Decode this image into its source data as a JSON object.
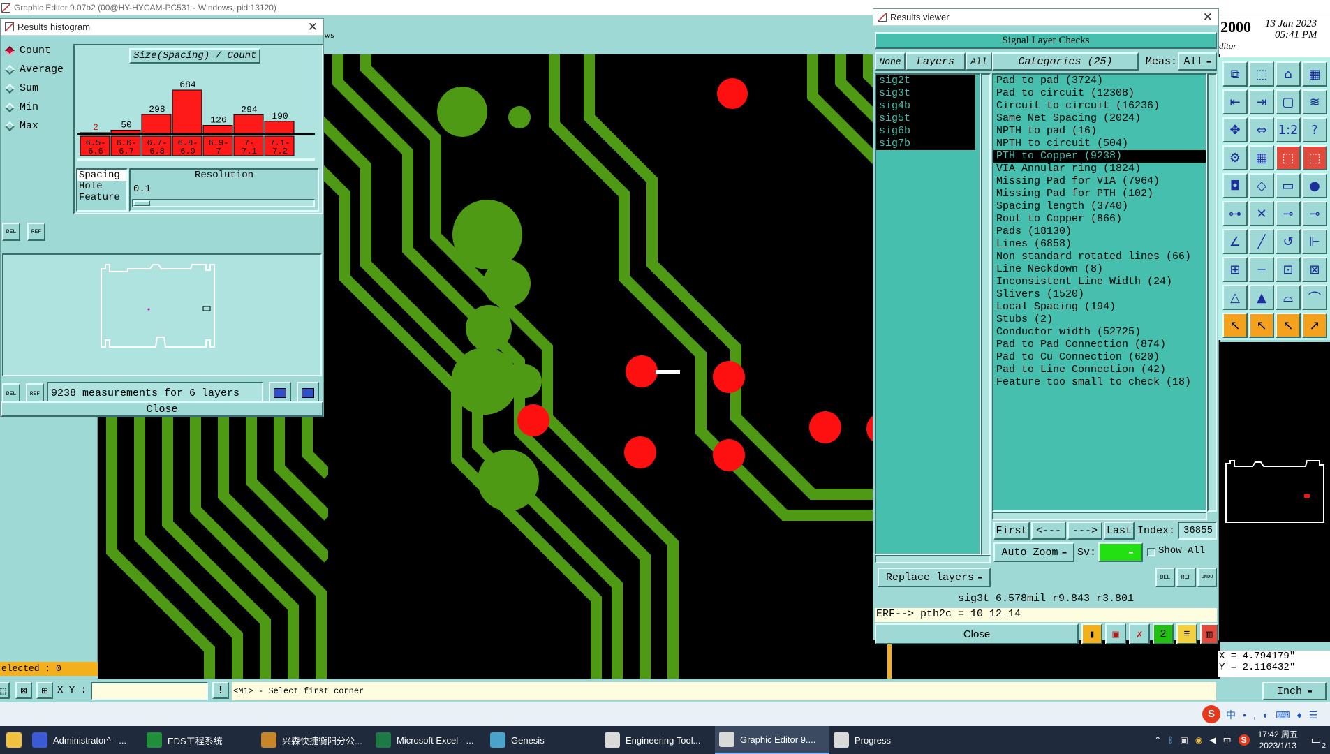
{
  "app": {
    "title": "Graphic Editor 9.07b2 (00@HY-HYCAM-PC531 - Windows, pid:13120)",
    "menu_fragment": "ws",
    "header_date": "13 Jan 2023",
    "header_year": "2000",
    "header_time": "05:41 PM",
    "header_editor": "ditor"
  },
  "histogram": {
    "window_title": "Results histogram",
    "modes": [
      "Count",
      "Average",
      "Sum",
      "Min",
      "Max"
    ],
    "selected_mode": "Count",
    "chart_title": "Size(Spacing) / Count",
    "bins": [
      {
        "count": "2",
        "range_top": "6.5-",
        "range_bottom": "6.6"
      },
      {
        "count": "50",
        "range_top": "6.6-",
        "range_bottom": "6.7"
      },
      {
        "count": "298",
        "range_top": "6.7-",
        "range_bottom": "6.8"
      },
      {
        "count": "684",
        "range_top": "6.8-",
        "range_bottom": "6.9"
      },
      {
        "count": "126",
        "range_top": "6.9-",
        "range_bottom": "7"
      },
      {
        "count": "294",
        "range_top": "7-",
        "range_bottom": "7.1"
      },
      {
        "count": "190",
        "range_top": "7.1-",
        "range_bottom": "7.2"
      }
    ],
    "type_list": [
      "Spacing",
      "Hole",
      "Feature"
    ],
    "type_selected": "Spacing",
    "resolution_label": "Resolution",
    "resolution_value": "0.1",
    "del_label": "DEL",
    "ref_label": "REF",
    "summary": "9238 measurements for 6 layers",
    "close_label": "Close"
  },
  "left_status": {
    "selected": "elected : 0"
  },
  "chart_data": {
    "type": "bar",
    "title": "Size(Spacing) / Count",
    "categories": [
      "6.5-6.6",
      "6.6-6.7",
      "6.7-6.8",
      "6.8-6.9",
      "6.9-7",
      "7-7.1",
      "7.1-7.2"
    ],
    "values": [
      2,
      50,
      298,
      684,
      126,
      294,
      190
    ],
    "xlabel": "",
    "ylabel": "",
    "ylim": [
      0,
      684
    ]
  },
  "viewer": {
    "window_title": "Results viewer",
    "header": "Signal Layer Checks",
    "btn_none": "None",
    "btn_layers": "Layers",
    "btn_all": "All",
    "categories_label": "Categories (25)",
    "meas_label": "Meas:",
    "meas_value": "All",
    "layers": [
      "sig2t",
      "sig3t",
      "sig4b",
      "sig5t",
      "sig6b",
      "sig7b"
    ],
    "categories": [
      "Pad to pad (3724)",
      "Pad to circuit (12308)",
      "Circuit to circuit (16236)",
      "Same Net Spacing (2024)",
      "NPTH to pad (16)",
      "NPTH to circuit (504)",
      "PTH to Copper (9238)",
      "VIA Annular ring (1824)",
      "Missing Pad for VIA (7964)",
      "Missing Pad for PTH (102)",
      "Spacing length (3740)",
      "Rout to Copper (866)",
      "Pads (18130)",
      "Lines (6858)",
      "Non standard rotated lines (66)",
      "Line Neckdown (8)",
      "Inconsistent Line Width (24)",
      "Slivers (1520)",
      "Local Spacing (194)",
      "Stubs (2)",
      "Conductor width (52725)",
      "Pad to Pad Connection (874)",
      "Pad to Cu Connection (620)",
      "Pad to Line Connection (42)",
      "Feature too small to check (18)"
    ],
    "selected_category": "PTH to Copper (9238)",
    "nav_first": "First",
    "nav_prev": "<---",
    "nav_next": "--->",
    "nav_last": "Last",
    "index_label": "Index:",
    "index_value": "36855",
    "auto_zoom": "Auto Zoom",
    "sv_label": "Sv:",
    "show_all": "Show All",
    "replace_layers": "Replace layers",
    "del_label": "DEL",
    "ref_label": "REF",
    "undo_label": "UNDO",
    "measure_line": "sig3t 6.578mil  r9.843  r3.801",
    "erf_line": "ERF--> pth2c = 10 12 14",
    "close_label": "Close"
  },
  "coords": {
    "x": "X = 4.794179\"",
    "y": "Y = 2.116432\""
  },
  "statusbar": {
    "xy_label": "X Y :",
    "prompt": "<M1> - Select first corner",
    "units": "Inch"
  },
  "taskbar": {
    "items": [
      {
        "label": "Administrator^ - ...",
        "color": "#3b5bd6"
      },
      {
        "label": "EDS工程系统",
        "color": "#1f8f3a"
      },
      {
        "label": "兴森快捷衡阳分公...",
        "color": "#c8862a"
      },
      {
        "label": "Microsoft Excel - ...",
        "color": "#1d7a45"
      },
      {
        "label": "Genesis",
        "color": "#4aa3c8"
      },
      {
        "label": "Engineering Tool...",
        "color": "#d9d9d9"
      },
      {
        "label": "Graphic Editor 9....",
        "color": "#d9d9d9"
      },
      {
        "label": "Progress",
        "color": "#d9d9d9"
      }
    ],
    "time": "17:42 周五",
    "date": "2023/1/13",
    "ime": "中",
    "notif_count": "2"
  }
}
